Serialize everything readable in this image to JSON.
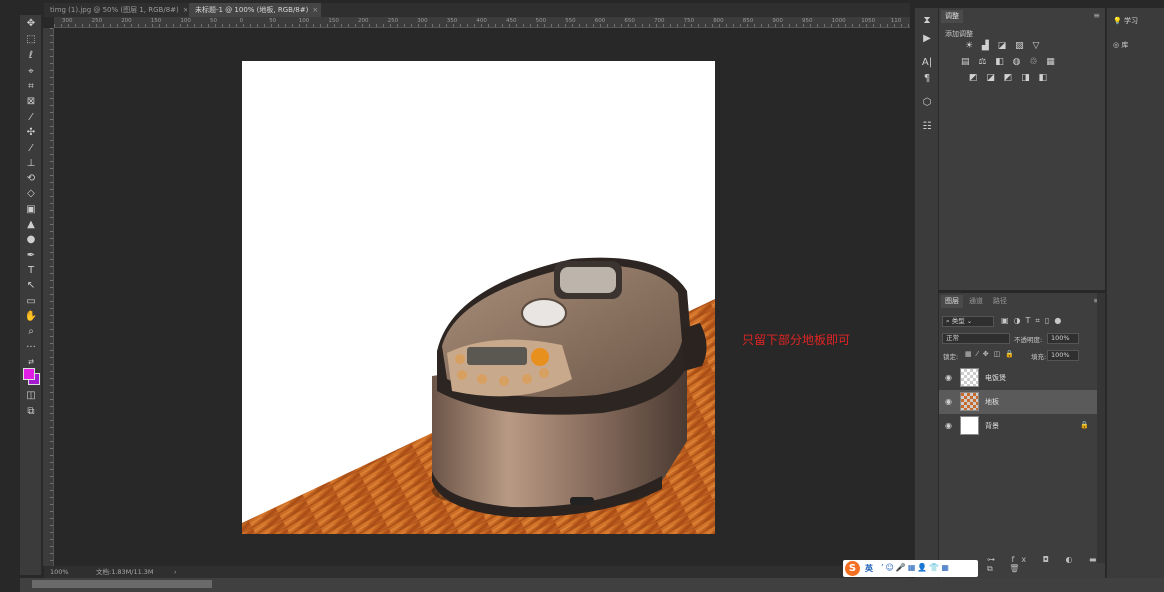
{
  "tabs": [
    {
      "label": "timg (1).jpg @ 50% (图层 1, RGB/8#)",
      "close": "×"
    },
    {
      "label": "未标题-1 @ 100% (地板, RGB/8#)",
      "close": "×"
    }
  ],
  "ruler_ticks": [
    "300",
    "250",
    "200",
    "150",
    "100",
    "50",
    "0",
    "50",
    "100",
    "150",
    "200",
    "250",
    "300",
    "350",
    "400",
    "450",
    "500",
    "550",
    "600",
    "650",
    "700",
    "750",
    "800",
    "850",
    "900",
    "950",
    "1000",
    "1050",
    "110"
  ],
  "canvas_note": "只留下部分地板即可",
  "status": {
    "zoom": "100%",
    "doc_info": "文档:1.83M/11.3M",
    "arrow": "›"
  },
  "adjustments_panel": {
    "tabs": [
      "调整"
    ],
    "add_label": "添加调整"
  },
  "layers_panel": {
    "tabs": [
      "图层",
      "通道",
      "路径"
    ],
    "filter_label": "类型",
    "blend_mode": "正常",
    "opacity_label": "不透明度:",
    "opacity_value": "100%",
    "lock_label": "锁定:",
    "fill_label": "填充:",
    "fill_value": "100%",
    "layers": [
      {
        "name": "电饭煲",
        "visible": true,
        "selected": false,
        "locked": false
      },
      {
        "name": "地板",
        "visible": true,
        "selected": true,
        "locked": false
      },
      {
        "name": "背景",
        "visible": true,
        "selected": false,
        "locked": true
      }
    ]
  },
  "right_panel": {
    "learn_label": "学习",
    "library_label": "库"
  },
  "ime": {
    "logo": "S",
    "lang": "英"
  },
  "colors": {
    "foreground": "#e01ee6",
    "background": "#a31bd1",
    "note": "#e02424",
    "accent": "#f36f21"
  }
}
